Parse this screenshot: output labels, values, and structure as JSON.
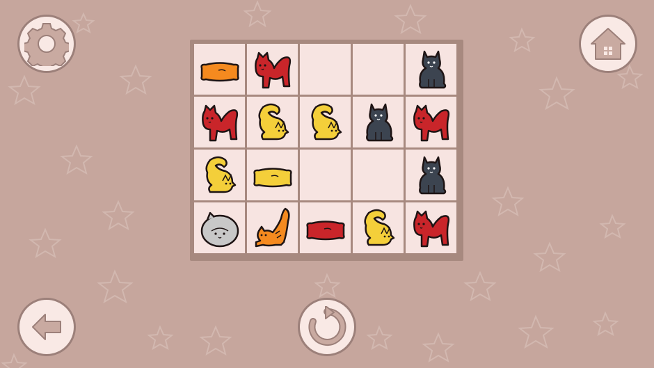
{
  "colors": {
    "background": "#c6a69d",
    "board_frame": "#a7897f",
    "cell": "#f7e4e1",
    "button_fill": "#f9e9e5",
    "button_outline": "#9c807a",
    "red": "#c9252a",
    "yellow": "#f4cf3a",
    "orange": "#f58a1f",
    "dark": "#3c4450",
    "gray": "#c8c8c8"
  },
  "buttons": {
    "settings": {
      "icon": "gear-icon"
    },
    "home": {
      "icon": "house-icon"
    },
    "back": {
      "icon": "arrow-left-icon"
    },
    "restart": {
      "icon": "restart-icon"
    }
  },
  "board": {
    "rows": 4,
    "cols": 5,
    "cells": [
      [
        {
          "piece": "cushion",
          "color": "orange"
        },
        {
          "piece": "cat-standing",
          "color": "red"
        },
        {
          "piece": "empty"
        },
        {
          "piece": "empty"
        },
        {
          "piece": "cat-sitting",
          "color": "dark"
        }
      ],
      [
        {
          "piece": "cat-standing",
          "color": "red"
        },
        {
          "piece": "cat-curled",
          "color": "yellow"
        },
        {
          "piece": "cat-curled",
          "color": "yellow"
        },
        {
          "piece": "cat-sitting",
          "color": "dark"
        },
        {
          "piece": "cat-standing",
          "color": "red"
        }
      ],
      [
        {
          "piece": "cat-curled",
          "color": "yellow"
        },
        {
          "piece": "cushion",
          "color": "yellow"
        },
        {
          "piece": "empty"
        },
        {
          "piece": "empty"
        },
        {
          "piece": "cat-sitting",
          "color": "dark"
        }
      ],
      [
        {
          "piece": "cat-ball",
          "color": "gray"
        },
        {
          "piece": "cat-stretching",
          "color": "orange"
        },
        {
          "piece": "cushion",
          "color": "red"
        },
        {
          "piece": "cat-curled",
          "color": "yellow"
        },
        {
          "piece": "cat-standing",
          "color": "red"
        }
      ]
    ]
  }
}
